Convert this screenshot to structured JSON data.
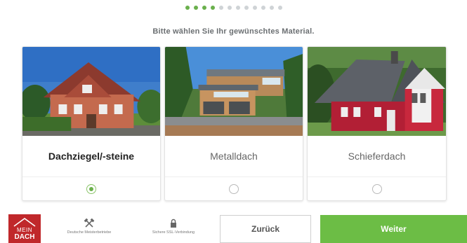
{
  "progress": {
    "total": 12,
    "completed": 4
  },
  "instruction": "Bitte wählen Sie Ihr gewünschtes Material.",
  "options": [
    {
      "label": "Dachziegel/-steine",
      "selected": true
    },
    {
      "label": "Metalldach",
      "selected": false
    },
    {
      "label": "Schieferdach",
      "selected": false
    }
  ],
  "footer": {
    "logo_line1": "MEIN",
    "logo_line2": "DACH",
    "badge1": "Deutsche Meisterbetriebe",
    "badge2": "Sichere SSL-Verbindung",
    "back_label": "Zurück",
    "next_label": "Weiter"
  },
  "colors": {
    "accent": "#6cbd45",
    "logo": "#c0282b"
  }
}
